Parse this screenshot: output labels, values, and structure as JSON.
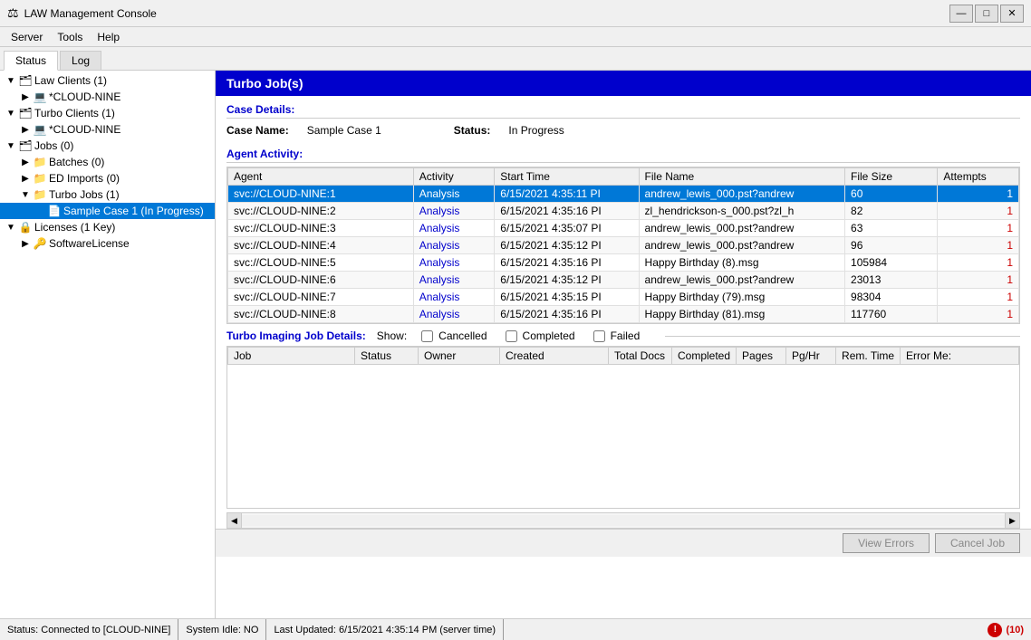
{
  "titleBar": {
    "title": "LAW Management Console",
    "icon": "⚖",
    "minimize": "—",
    "maximize": "□",
    "close": "✕"
  },
  "menuBar": {
    "items": [
      "Server",
      "Tools",
      "Help"
    ]
  },
  "tabs": [
    {
      "label": "Status",
      "active": true
    },
    {
      "label": "Log",
      "active": false
    }
  ],
  "leftPanel": {
    "tree": [
      {
        "level": 0,
        "expanded": true,
        "icon": "🗂",
        "label": "Law Clients (1)",
        "type": "folder"
      },
      {
        "level": 1,
        "expanded": false,
        "icon": "💻",
        "label": "*CLOUD-NINE",
        "type": "client"
      },
      {
        "level": 0,
        "expanded": true,
        "icon": "🗂",
        "label": "Turbo Clients (1)",
        "type": "folder"
      },
      {
        "level": 1,
        "expanded": false,
        "icon": "💻",
        "label": "*CLOUD-NINE",
        "type": "client"
      },
      {
        "level": 0,
        "expanded": true,
        "icon": "🗂",
        "label": "Jobs (0)",
        "type": "folder"
      },
      {
        "level": 1,
        "expanded": false,
        "icon": "📁",
        "label": "Batches (0)",
        "type": "sub"
      },
      {
        "level": 1,
        "expanded": false,
        "icon": "📁",
        "label": "ED Imports (0)",
        "type": "sub"
      },
      {
        "level": 1,
        "expanded": true,
        "icon": "📁",
        "label": "Turbo Jobs (1)",
        "type": "sub"
      },
      {
        "level": 2,
        "expanded": false,
        "icon": "📄",
        "label": "Sample Case 1 (In Progress)",
        "type": "job",
        "selected": true
      },
      {
        "level": 0,
        "expanded": true,
        "icon": "🔒",
        "label": "Licenses (1 Key)",
        "type": "folder"
      },
      {
        "level": 1,
        "expanded": false,
        "icon": "🔑",
        "label": "SoftwareLicense",
        "type": "license"
      }
    ]
  },
  "rightPanel": {
    "header": "Turbo Job(s)",
    "caseDetails": {
      "sectionTitle": "Case Details:",
      "caseNameLabel": "Case Name:",
      "caseName": "Sample Case 1",
      "statusLabel": "Status:",
      "statusValue": "In Progress"
    },
    "agentActivity": {
      "sectionTitle": "Agent Activity:",
      "columns": [
        "Agent",
        "Activity",
        "Start Time",
        "File Name",
        "File Size",
        "Attempts"
      ],
      "rows": [
        {
          "agent": "svc://CLOUD-NINE:1",
          "activity": "Analysis",
          "startTime": "6/15/2021 4:35:11 PI",
          "fileName": "andrew_lewis_000.pst?andrew",
          "fileSize": "60",
          "attempts": "1",
          "selected": true
        },
        {
          "agent": "svc://CLOUD-NINE:2",
          "activity": "Analysis",
          "startTime": "6/15/2021 4:35:16 PI",
          "fileName": "zl_hendrickson-s_000.pst?zl_h",
          "fileSize": "82",
          "attempts": "1",
          "selected": false
        },
        {
          "agent": "svc://CLOUD-NINE:3",
          "activity": "Analysis",
          "startTime": "6/15/2021 4:35:07 PI",
          "fileName": "andrew_lewis_000.pst?andrew",
          "fileSize": "63",
          "attempts": "1",
          "selected": false
        },
        {
          "agent": "svc://CLOUD-NINE:4",
          "activity": "Analysis",
          "startTime": "6/15/2021 4:35:12 PI",
          "fileName": "andrew_lewis_000.pst?andrew",
          "fileSize": "96",
          "attempts": "1",
          "selected": false
        },
        {
          "agent": "svc://CLOUD-NINE:5",
          "activity": "Analysis",
          "startTime": "6/15/2021 4:35:16 PI",
          "fileName": "Happy Birthday (8).msg",
          "fileSize": "105984",
          "attempts": "1",
          "selected": false
        },
        {
          "agent": "svc://CLOUD-NINE:6",
          "activity": "Analysis",
          "startTime": "6/15/2021 4:35:12 PI",
          "fileName": "andrew_lewis_000.pst?andrew",
          "fileSize": "23013",
          "attempts": "1",
          "selected": false
        },
        {
          "agent": "svc://CLOUD-NINE:7",
          "activity": "Analysis",
          "startTime": "6/15/2021 4:35:15 PI",
          "fileName": "Happy Birthday (79).msg",
          "fileSize": "98304",
          "attempts": "1",
          "selected": false
        },
        {
          "agent": "svc://CLOUD-NINE:8",
          "activity": "Analysis",
          "startTime": "6/15/2021 4:35:16 PI",
          "fileName": "Happy Birthday (81).msg",
          "fileSize": "117760",
          "attempts": "1",
          "selected": false
        }
      ]
    },
    "imagingDetails": {
      "sectionTitle": "Turbo Imaging Job Details:",
      "showLabel": "Show:",
      "checkboxes": [
        {
          "label": "Cancelled",
          "checked": false
        },
        {
          "label": "Completed",
          "checked": false
        },
        {
          "label": "Failed",
          "checked": false
        }
      ],
      "columns": [
        "Job",
        "Status",
        "Owner",
        "Created",
        "Total Docs",
        "Completed",
        "Pages",
        "Pg/Hr",
        "Rem. Time",
        "Error Me:"
      ],
      "rows": []
    },
    "buttons": {
      "viewErrors": "View Errors",
      "cancelJob": "Cancel Job"
    }
  },
  "statusBar": {
    "connection": "Status: Connected to [CLOUD-NINE]",
    "idle": "System Idle: NO",
    "lastUpdated": "Last Updated: 6/15/2021 4:35:14 PM (server time)",
    "alertCount": "(10)"
  }
}
